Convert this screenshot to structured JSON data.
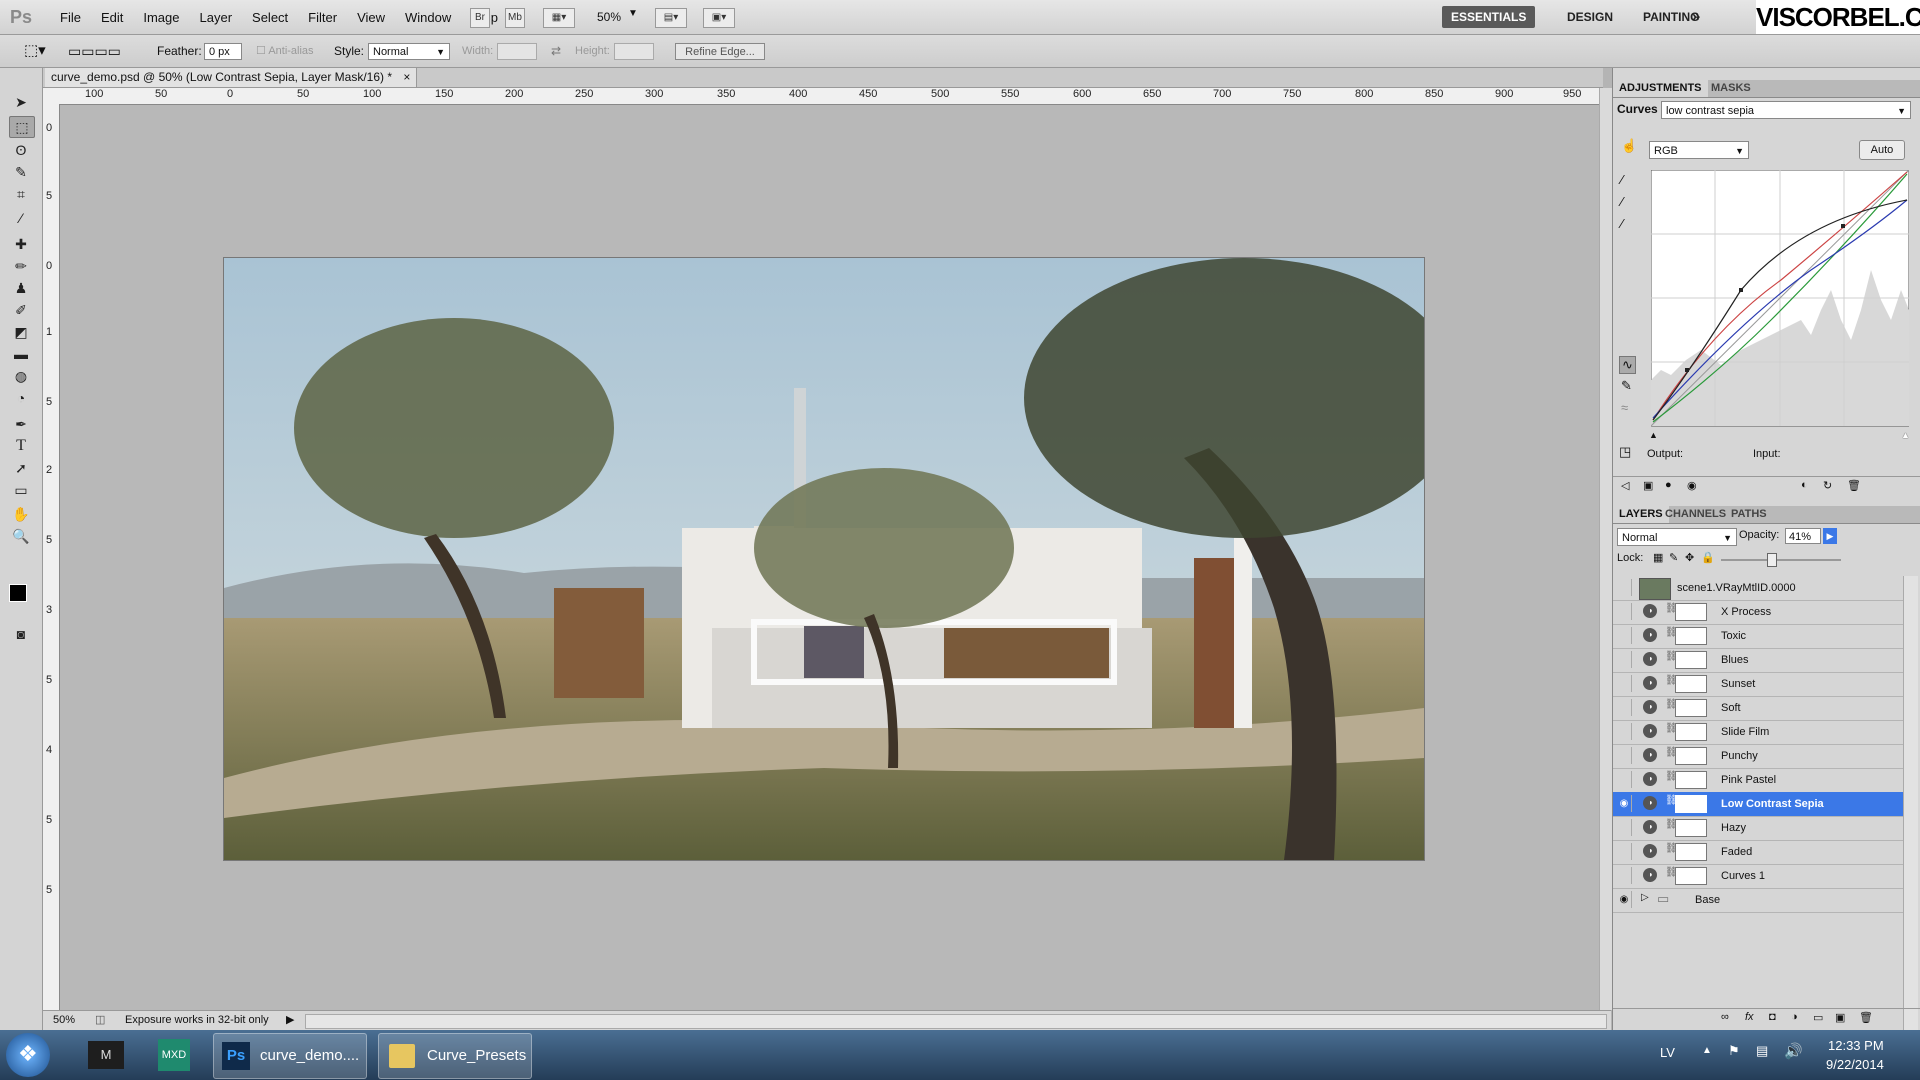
{
  "app": {
    "logo": "Ps"
  },
  "menu": [
    "File",
    "Edit",
    "Image",
    "Layer",
    "Select",
    "Filter",
    "View",
    "Window",
    "Help"
  ],
  "menubar": {
    "bridge": "Br",
    "minibridge": "Mb",
    "zoom": "50%"
  },
  "workspaces": {
    "essentials": "ESSENTIALS",
    "design": "DESIGN",
    "painting": "PAINTING",
    "more": "»"
  },
  "brand": "VISCORBEL.COM",
  "options": {
    "feather_label": "Feather:",
    "feather_value": "0 px",
    "antialias_label": "Anti-alias",
    "style_label": "Style:",
    "style_value": "Normal",
    "width_label": "Width:",
    "height_label": "Height:",
    "refine_edge": "Refine Edge..."
  },
  "document": {
    "tab_title": "curve_demo.psd @ 50% (Low Contrast Sepia, Layer Mask/16) *",
    "close": "×",
    "zoom": "50%",
    "status": "Exposure works in 32-bit only"
  },
  "ruler_top": [
    "100",
    "50",
    "0",
    "50",
    "100",
    "150",
    "200",
    "250",
    "300",
    "350",
    "400",
    "450",
    "500",
    "550",
    "600",
    "650",
    "700",
    "750",
    "800",
    "850",
    "900",
    "950"
  ],
  "ruler_left": [
    "0",
    "5",
    "0",
    "1",
    "5",
    "2",
    "5",
    "3",
    "5",
    "4",
    "5",
    "5"
  ],
  "adjustments": {
    "tabs": [
      "ADJUSTMENTS",
      "MASKS"
    ],
    "type": "Curves",
    "preset": "low contrast sepia",
    "channel": "RGB",
    "auto": "Auto",
    "output_label": "Output:",
    "input_label": "Input:"
  },
  "layers": {
    "tabs": [
      "LAYERS",
      "CHANNELS",
      "PATHS"
    ],
    "blend": "Normal",
    "opacity_label": "Opacity:",
    "opacity_value": "41%",
    "lock_label": "Lock:",
    "base_layer": "scene1.VRayMtlID.0000",
    "items": [
      "X Process",
      "Toxic",
      "Blues",
      "Sunset",
      "Soft",
      "Slide Film",
      "Punchy",
      "Pink Pastel",
      "Low Contrast Sepia",
      "Hazy",
      "Faded",
      "Curves 1"
    ],
    "selected": "Low Contrast Sepia",
    "group": "Base"
  },
  "taskbar": {
    "items": [
      "curve_demo....",
      "Curve_Presets"
    ],
    "lang": "LV",
    "time": "12:33 PM",
    "date": "9/22/2014"
  }
}
